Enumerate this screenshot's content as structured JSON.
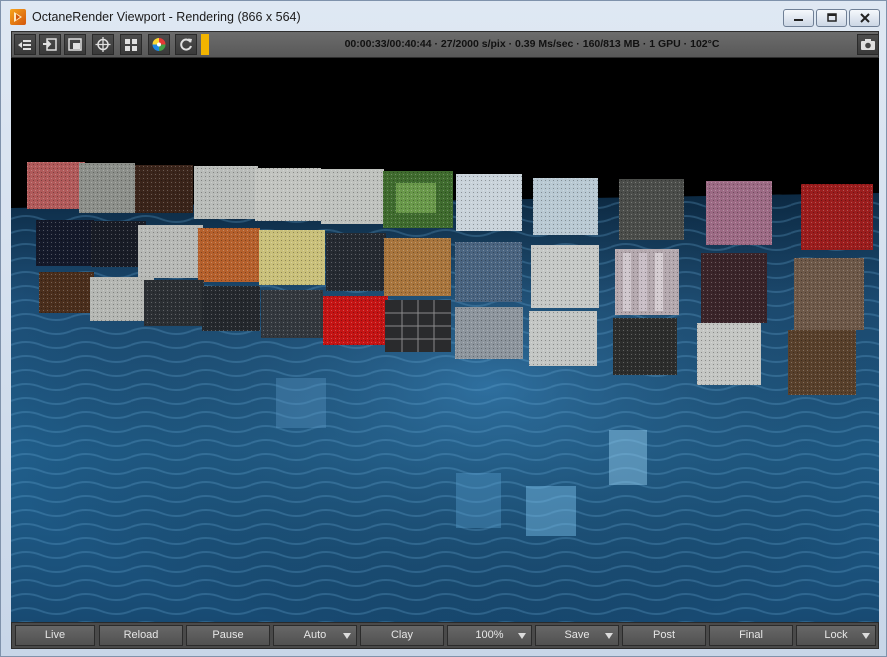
{
  "window": {
    "title": "OctaneRender Viewport - Rendering (866 x 564)"
  },
  "toolbar": {
    "buttons": [
      "toggle-panel-icon",
      "import-icon",
      "region-render-icon",
      "focus-picker-icon",
      "grid-icon",
      "color-picker-icon",
      "reload-icon"
    ],
    "status": "00:00:33/00:40:44 · 27/2000 s/pix · 0.39 Ms/sec · 160/813 MB · 1 GPU · 102°C",
    "progress_color": "#f2b400"
  },
  "viewport": {
    "content": "render-preview",
    "background_color": "#000000",
    "floor_color": "#1e4d75"
  },
  "bottom_bar": {
    "live": "Live",
    "reload": "Reload",
    "pause": "Pause",
    "auto": "Auto",
    "clay": "Clay",
    "zoom": "100%",
    "save": "Save",
    "post": "Post",
    "final": "Final",
    "lock": "Lock"
  }
}
